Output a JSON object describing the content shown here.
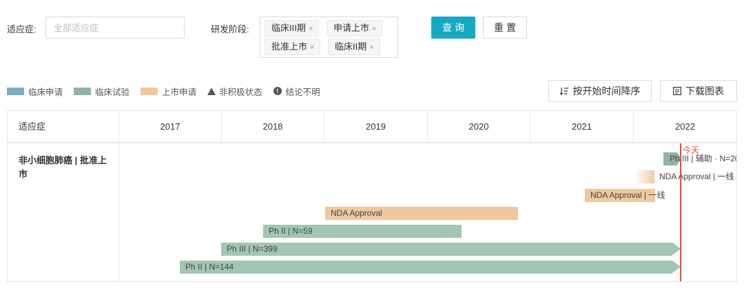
{
  "filters": {
    "indication_label": "适应症:",
    "indication_placeholder": "全部适应症",
    "stage_label": "研发阶段:",
    "stage_tags": [
      "临床III期",
      "申请上市",
      "批准上市",
      "临床II期"
    ],
    "tag_close": "×",
    "query_button": "查询",
    "reset_button": "重置"
  },
  "legend": {
    "items": [
      {
        "label": "临床申请",
        "color": "#7aaec6"
      },
      {
        "label": "临床试验",
        "color": "#8cb5a2"
      },
      {
        "label": "上市申请",
        "color": "#efc89d"
      }
    ],
    "inactive_label": "非积极状态",
    "unclear_label": "结论不明",
    "unclear_glyph": "!"
  },
  "toolbar": {
    "sort_button": "按开始时间降序",
    "download_button": "下载图表"
  },
  "gantt": {
    "header_first": "适应症",
    "years": [
      "2017",
      "2018",
      "2019",
      "2020",
      "2021",
      "2022"
    ],
    "today_label": "今天",
    "row_name": "非小细胞肺癌 | 批准上市",
    "bars": [
      {
        "label": "Ph III | 辅助 · N=20",
        "phase": "临床试验"
      },
      {
        "label": "NDA Approval | 一线",
        "phase": "上市申请"
      },
      {
        "label": "NDA Approval | 一线",
        "phase": "上市申请"
      },
      {
        "label": "NDA Approval",
        "phase": "上市申请"
      },
      {
        "label": "Ph II | N=59",
        "phase": "临床试验"
      },
      {
        "label": "Ph III | N=399",
        "phase": "临床试验"
      },
      {
        "label": "Ph II | N=144",
        "phase": "临床试验"
      }
    ]
  }
}
